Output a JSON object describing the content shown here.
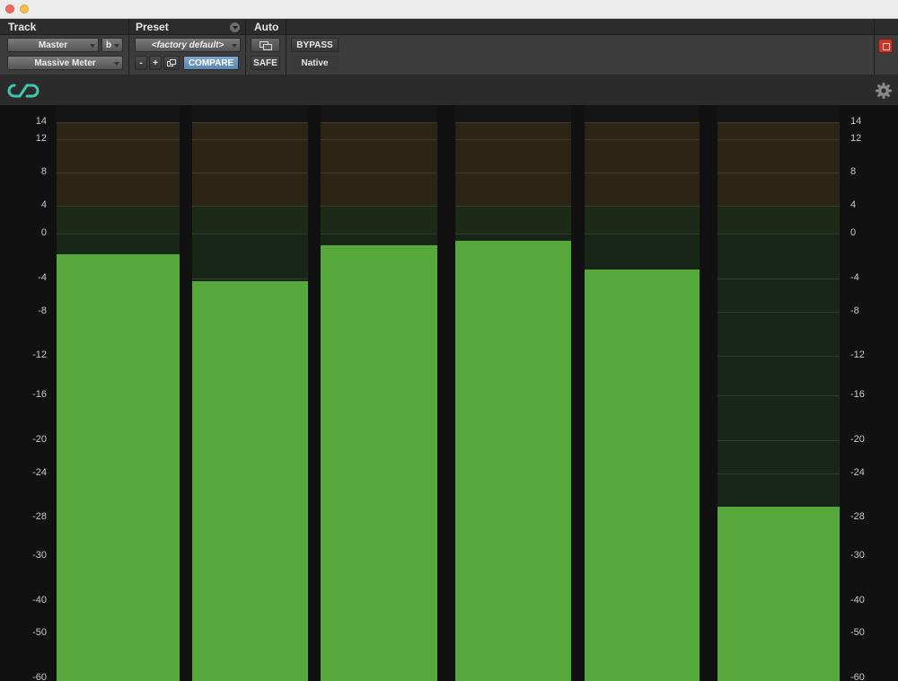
{
  "header": {
    "track_label": "Track",
    "preset_label": "Preset",
    "auto_label": "Auto",
    "track_name": "Master",
    "track_variant": "b",
    "plugin_name": "Massive Meter",
    "preset_name": "<factory default>",
    "minus_label": "-",
    "plus_label": "+",
    "compare_label": "COMPARE",
    "safe_label": "SAFE",
    "bypass_label": "BYPASS",
    "native_label": "Native"
  },
  "meter": {
    "scale_labels": [
      "14",
      "12",
      "8",
      "4",
      "0",
      "-4",
      "-8",
      "-12",
      "-16",
      "-20",
      "-24",
      "-28",
      "-30",
      "-40",
      "-50",
      "-60"
    ],
    "channels": [
      {
        "level_db": -1.8
      },
      {
        "level_db": -4.3
      },
      {
        "level_db": -1.0
      },
      {
        "level_db": -0.6
      },
      {
        "level_db": -3.2
      },
      {
        "level_db": -27.0
      }
    ],
    "colors": {
      "bar": "#56a83b",
      "hot_zone": "#2c2415",
      "warn_zone": "#1d2a17",
      "safe_zone": "#182617"
    }
  }
}
